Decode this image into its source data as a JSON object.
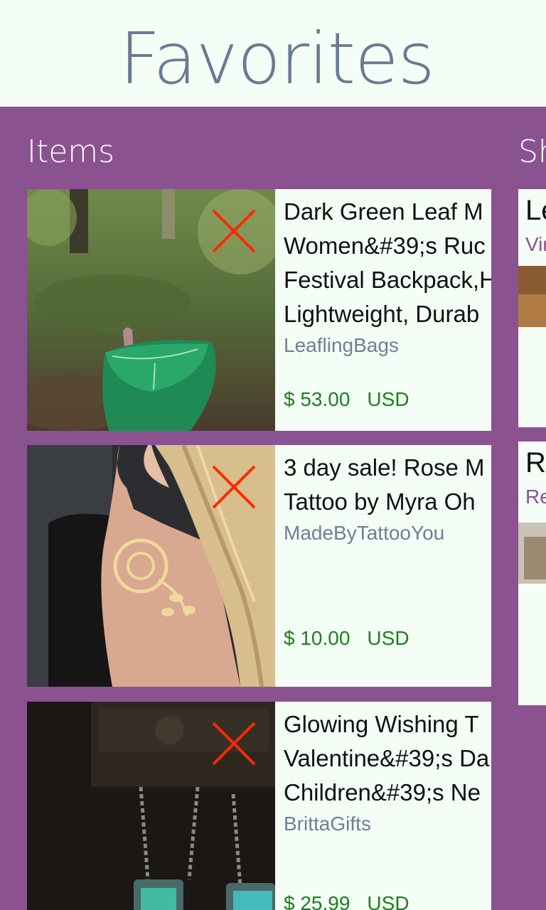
{
  "page_title": "Favorites",
  "sections": {
    "items_title": "Items",
    "shops_title": "Sh"
  },
  "items": [
    {
      "title_lines": [
        "Dark Green Leaf M",
        "Women&#39;s Ruc",
        "Festival Backpack,H",
        "Lightweight, Durab"
      ],
      "shop": "LeaflingBags",
      "price": "$ 53.00",
      "currency": "USD",
      "image": "green-leaf-backpack-photo"
    },
    {
      "title_lines": [
        "3 day sale! Rose M",
        "Tattoo by Myra Oh"
      ],
      "shop": "MadeByTattooYou",
      "price": "$ 10.00",
      "currency": "USD",
      "image": "gold-rose-tattoo-photo"
    },
    {
      "title_lines": [
        "Glowing Wishing T",
        "Valentine&#39;s Da",
        "Children&#39;s Ne"
      ],
      "shop": "BrittaGifts",
      "price": "$ 25.99",
      "currency": "USD",
      "image": "glowing-necklace-photo"
    }
  ],
  "shops": [
    {
      "name": "Le",
      "sub": "Vir"
    },
    {
      "name": "Re",
      "sub": "Re"
    }
  ],
  "icons": {
    "remove": "close-icon"
  },
  "colors": {
    "accent": "#8b5290",
    "background": "#f4fdf6",
    "price": "#1f7f1f",
    "remove": "#ff2a00"
  }
}
